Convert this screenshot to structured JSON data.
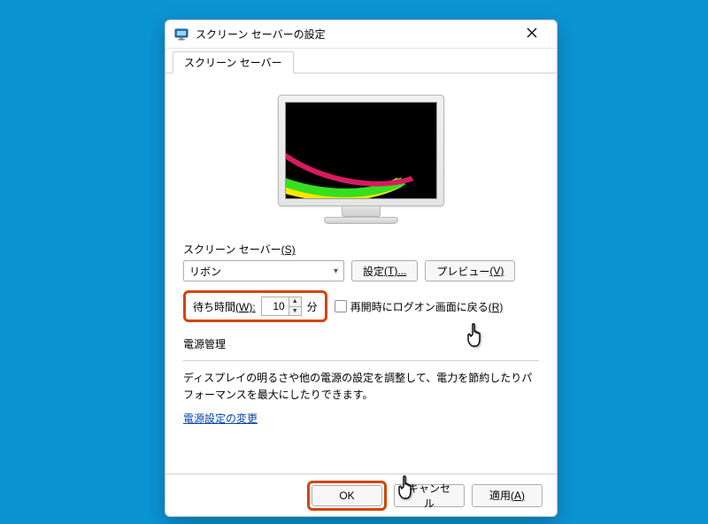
{
  "window": {
    "title": "スクリーン セーバーの設定"
  },
  "tab": {
    "label": "スクリーン セーバー"
  },
  "screensaver": {
    "section_label": "スクリーン セーバー",
    "section_hotkey_suffix": "(S)",
    "selected": "リボン",
    "settings_button": "設定",
    "settings_hotkey_suffix": "(T)...",
    "preview_button": "プレビュー",
    "preview_hotkey_suffix": "(V)"
  },
  "wait": {
    "label": "待ち時間",
    "label_hotkey_suffix": "(W):",
    "value": "10",
    "unit": "分",
    "resume_label": "再開時にログオン画面に戻る",
    "resume_hotkey_suffix": "(R)",
    "resume_checked": false
  },
  "power": {
    "section_label": "電源管理",
    "body": "ディスプレイの明るさや他の電源の設定を調整して、電力を節約したりパフォーマンスを最大にしたりできます。",
    "link": "電源設定の変更"
  },
  "buttons": {
    "ok": "OK",
    "cancel": "キャンセル",
    "apply": "適用",
    "apply_hotkey_suffix": "(A)"
  },
  "highlight_color": "#d24500"
}
